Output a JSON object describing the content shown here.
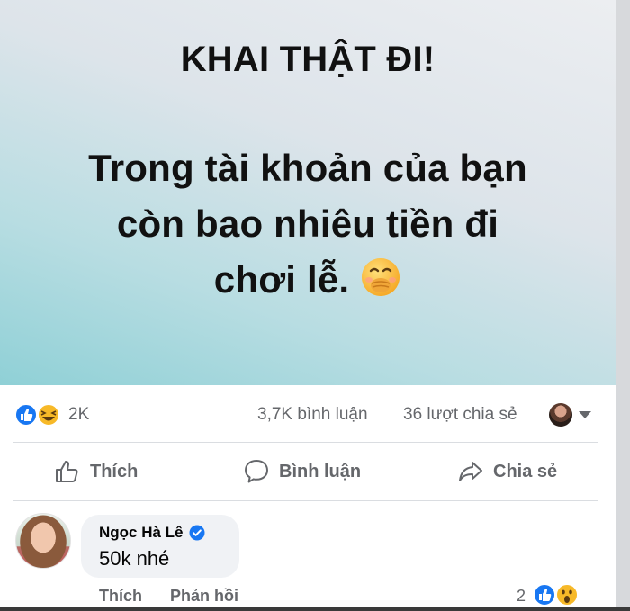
{
  "post": {
    "headline": "KHAI THẬT ĐI!",
    "question_line1": "Trong tài khoản của bạn",
    "question_line2": "còn bao nhiêu tiền đi",
    "question_line3": "chơi lễ.",
    "emoji": "face-with-hand-over-mouth"
  },
  "stats": {
    "reaction_count": "2K",
    "comments": "3,7K bình luận",
    "shares": "36 lượt chia sẻ",
    "reactions": [
      "like",
      "haha"
    ]
  },
  "actions": {
    "like": "Thích",
    "comment": "Bình luận",
    "share": "Chia sẻ"
  },
  "comment": {
    "author": "Ngọc Hà Lê",
    "verified": true,
    "text": "50k nhé",
    "like_label": "Thích",
    "reply_label": "Phản hồi",
    "reaction_count": "2",
    "reactions": [
      "like",
      "wow"
    ]
  },
  "colors": {
    "like_blue": "#1877f2",
    "haha_yellow": "#f7b928",
    "muted_text": "#65676b"
  }
}
